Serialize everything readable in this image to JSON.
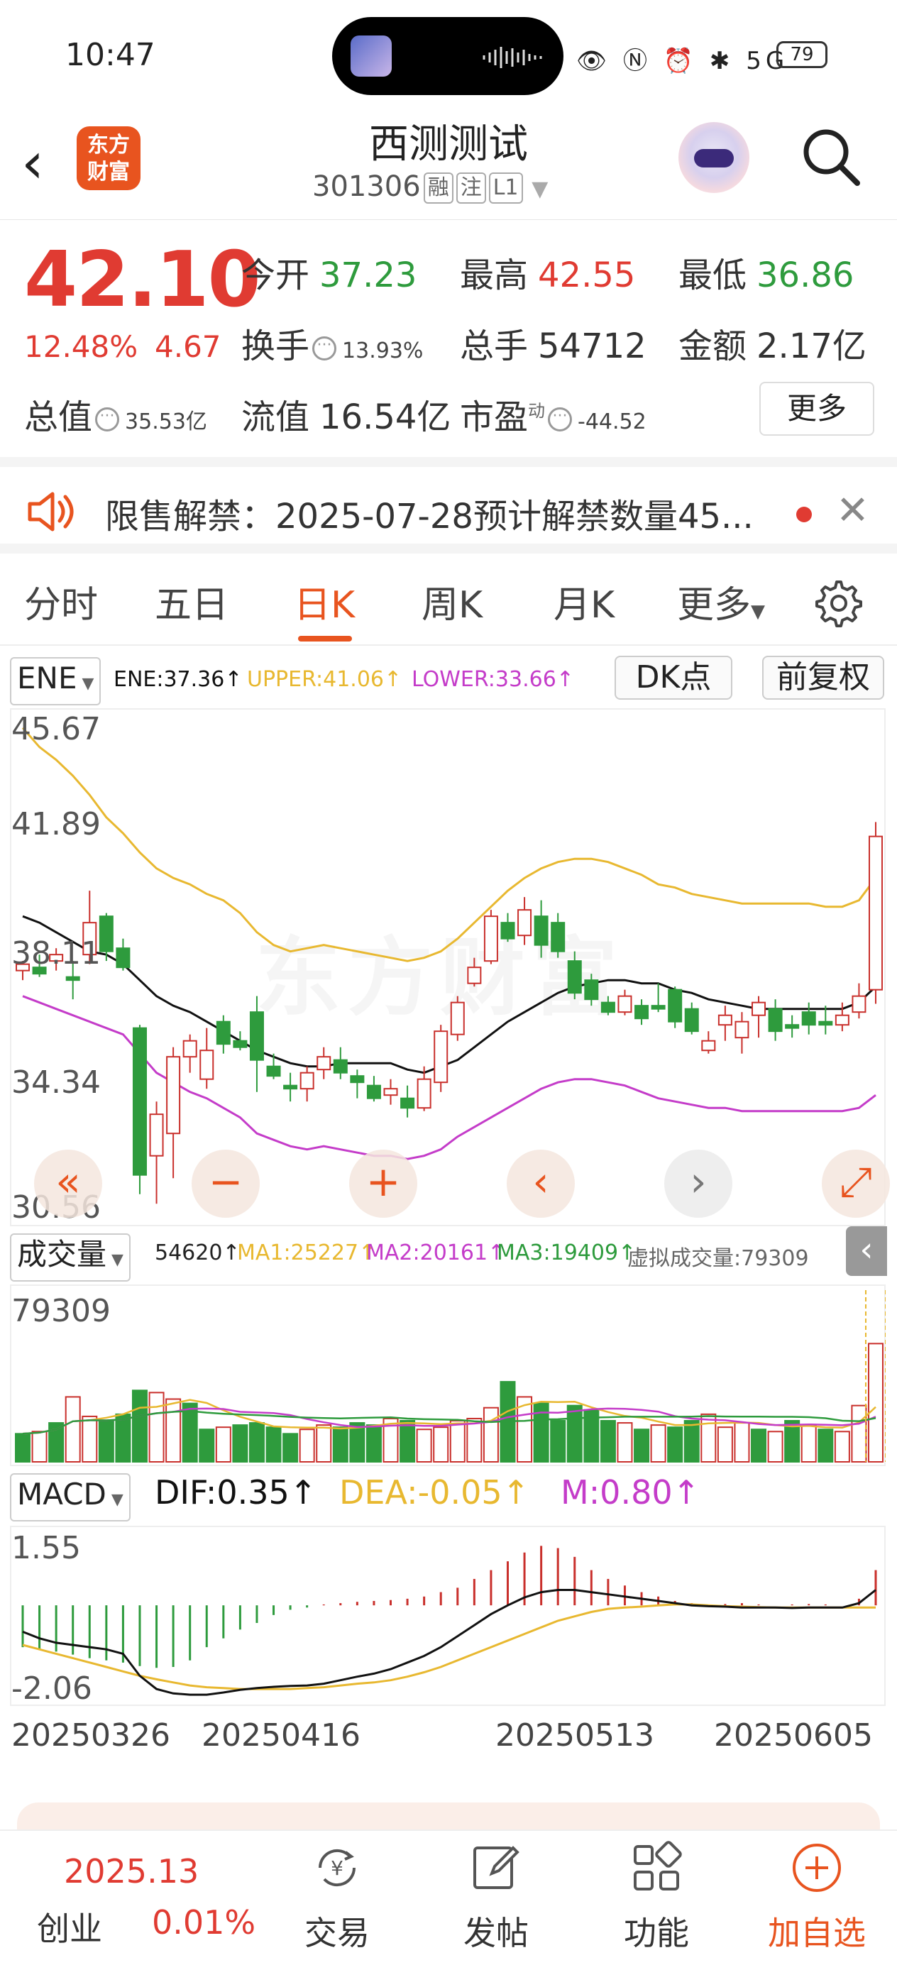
{
  "status_bar": {
    "time": "10:47",
    "icons": "👁 Ⓝ ⏰ ✱ 5G",
    "battery": "79"
  },
  "header": {
    "logo": "东方\n财富",
    "logo_l1": "东方",
    "logo_l2": "财富",
    "title": "西测测试",
    "code": "301306",
    "tags": [
      "融",
      "注",
      "L1"
    ]
  },
  "quote": {
    "price": "42.10",
    "change_pct": "12.48%",
    "change": "4.67",
    "open_label": "今开",
    "open": "37.23",
    "high_label": "最高",
    "high": "42.55",
    "low_label": "最低",
    "low": "36.86",
    "turnover_label": "换手",
    "turnover": "13.93%",
    "volume_label": "总手",
    "volume": "54712",
    "amount_label": "金额",
    "amount": "2.17亿",
    "mktcap_label": "总值",
    "mktcap": "35.53亿",
    "float_label": "流值",
    "float": "16.54亿",
    "pe_label": "市盈",
    "pe_sup": "动",
    "pe": "-44.52",
    "more": "更多"
  },
  "notice": {
    "text": "限售解禁：2025-07-28预计解禁数量45..."
  },
  "tabs": [
    "分时",
    "五日",
    "日K",
    "周K",
    "月K",
    "更多"
  ],
  "active_tab": "日K",
  "kline_legend": {
    "indicator": "ENE",
    "ene": "ENE:37.36↑",
    "upper": "UPPER:41.06↑",
    "lower": "LOWER:33.66↑",
    "dk": "DK点",
    "adjust": "前复权",
    "colors": {
      "ene": "#111111",
      "upper": "#e8b830",
      "lower": "#c43cc9",
      "up": "#c9302c",
      "down": "#2e9b3d"
    }
  },
  "kline_axis": {
    "max": "45.67",
    "l2": "41.89",
    "l3": "38.11",
    "l4": "34.34",
    "min": "30.56"
  },
  "volume_legend": {
    "indicator": "成交量",
    "vol": "54620↑",
    "ma1": "MA1:25227↑",
    "ma2": "MA2:20161↑",
    "ma3": "MA3:19409↑",
    "virtual": "虚拟成交量:79309",
    "max": "79309"
  },
  "macd_legend": {
    "indicator": "MACD",
    "dif": "DIF:0.35↑",
    "dea": "DEA:-0.05↑",
    "m": "M:0.80↑",
    "max": "1.55",
    "min": "-2.06"
  },
  "dates": [
    "20250326",
    "20250416",
    "20250513",
    "20250605"
  ],
  "controls": [
    "«",
    "−",
    "+",
    "‹",
    "›",
    "⤢"
  ],
  "bottom": {
    "index_value": "2025.13",
    "index_name": "创业",
    "index_pct": "0.01%",
    "items": [
      "交易",
      "发帖",
      "功能",
      "加自选"
    ]
  },
  "chart_data": {
    "type": "candlestick",
    "y_range": [
      30.56,
      45.67
    ],
    "candles": [
      [
        37.9,
        38.2,
        37.6,
        38.1
      ],
      [
        38.0,
        38.4,
        37.7,
        37.8
      ],
      [
        38.2,
        38.6,
        37.9,
        38.4
      ],
      [
        37.7,
        38.2,
        37.0,
        37.6
      ],
      [
        38.4,
        40.4,
        38.1,
        39.4
      ],
      [
        39.6,
        39.7,
        38.2,
        38.5
      ],
      [
        38.6,
        38.9,
        37.9,
        38.0
      ],
      [
        36.1,
        36.2,
        30.9,
        31.5
      ],
      [
        32.1,
        33.8,
        30.6,
        33.4
      ],
      [
        32.8,
        35.5,
        31.4,
        35.2
      ],
      [
        35.2,
        35.9,
        34.7,
        35.7
      ],
      [
        34.5,
        36.1,
        34.2,
        35.4
      ],
      [
        36.3,
        36.5,
        35.3,
        35.6
      ],
      [
        35.7,
        36.0,
        35.4,
        35.5
      ],
      [
        36.6,
        37.1,
        34.1,
        35.1
      ],
      [
        34.9,
        35.3,
        34.5,
        34.6
      ],
      [
        34.3,
        34.7,
        33.8,
        34.2
      ],
      [
        34.2,
        34.9,
        33.8,
        34.7
      ],
      [
        34.8,
        35.5,
        34.5,
        35.2
      ],
      [
        35.1,
        35.5,
        34.5,
        34.7
      ],
      [
        34.6,
        34.8,
        33.9,
        34.4
      ],
      [
        34.3,
        34.6,
        33.8,
        33.9
      ],
      [
        34.0,
        34.5,
        33.7,
        34.2
      ],
      [
        33.9,
        34.3,
        33.3,
        33.6
      ],
      [
        33.6,
        34.9,
        33.5,
        34.5
      ],
      [
        34.4,
        36.2,
        34.1,
        36.0
      ],
      [
        35.9,
        37.1,
        35.7,
        36.9
      ],
      [
        37.5,
        38.3,
        37.4,
        38.0
      ],
      [
        38.2,
        39.8,
        38.1,
        39.6
      ],
      [
        39.4,
        39.7,
        38.8,
        38.9
      ],
      [
        39.0,
        40.2,
        38.7,
        39.8
      ],
      [
        39.6,
        40.1,
        38.3,
        38.7
      ],
      [
        39.4,
        39.7,
        38.3,
        38.5
      ],
      [
        38.2,
        38.5,
        37.0,
        37.2
      ],
      [
        37.6,
        37.8,
        36.8,
        37.0
      ],
      [
        36.9,
        37.1,
        36.5,
        36.6
      ],
      [
        36.6,
        37.3,
        36.5,
        37.1
      ],
      [
        36.8,
        37.0,
        36.2,
        36.4
      ],
      [
        36.8,
        37.5,
        36.6,
        36.7
      ],
      [
        37.3,
        37.4,
        36.1,
        36.3
      ],
      [
        36.7,
        36.9,
        35.9,
        36.0
      ],
      [
        35.4,
        36.0,
        35.3,
        35.7
      ],
      [
        36.2,
        36.8,
        35.7,
        36.5
      ],
      [
        35.8,
        36.6,
        35.3,
        36.3
      ],
      [
        36.5,
        37.1,
        35.8,
        36.9
      ],
      [
        36.7,
        37.0,
        35.7,
        36.0
      ],
      [
        36.2,
        36.5,
        35.8,
        36.1
      ],
      [
        36.6,
        36.9,
        35.9,
        36.2
      ],
      [
        36.3,
        36.8,
        35.9,
        36.2
      ],
      [
        36.2,
        36.9,
        36.0,
        36.5
      ],
      [
        36.6,
        37.5,
        36.4,
        37.1
      ],
      [
        37.3,
        42.55,
        36.86,
        42.1
      ]
    ],
    "ene": [
      39.6,
      39.4,
      39.1,
      38.8,
      38.5,
      38.4,
      38.1,
      37.6,
      37.1,
      36.8,
      36.6,
      36.3,
      36.0,
      35.7,
      35.4,
      35.2,
      35.0,
      34.9,
      34.9,
      35.0,
      35.0,
      35.0,
      35.0,
      34.8,
      34.7,
      34.9,
      35.1,
      35.5,
      35.9,
      36.3,
      36.6,
      36.9,
      37.2,
      37.4,
      37.5,
      37.6,
      37.6,
      37.5,
      37.5,
      37.3,
      37.2,
      37.0,
      36.9,
      36.8,
      36.7,
      36.7,
      36.7,
      36.7,
      36.7,
      36.7,
      36.9,
      37.4
    ],
    "upper": [
      45.5,
      44.9,
      44.5,
      44.0,
      43.4,
      42.7,
      42.2,
      41.6,
      41.1,
      40.8,
      40.6,
      40.3,
      40.1,
      39.7,
      39.1,
      38.7,
      38.5,
      38.6,
      38.7,
      38.6,
      38.5,
      38.4,
      38.3,
      38.2,
      38.3,
      38.5,
      38.9,
      39.4,
      39.9,
      40.4,
      40.8,
      41.1,
      41.3,
      41.4,
      41.4,
      41.3,
      41.1,
      40.9,
      40.6,
      40.5,
      40.3,
      40.2,
      40.1,
      40.0,
      40.0,
      40.0,
      40.0,
      40.0,
      39.9,
      39.9,
      40.1,
      40.8
    ],
    "lower": [
      37.1,
      36.9,
      36.7,
      36.5,
      36.3,
      36.1,
      35.9,
      35.3,
      34.7,
      34.4,
      34.1,
      33.9,
      33.6,
      33.3,
      32.8,
      32.6,
      32.4,
      32.3,
      32.4,
      32.3,
      32.2,
      32.1,
      32.1,
      32.0,
      32.1,
      32.3,
      32.7,
      33.0,
      33.3,
      33.6,
      33.9,
      34.2,
      34.4,
      34.5,
      34.5,
      34.4,
      34.3,
      34.1,
      33.9,
      33.8,
      33.7,
      33.6,
      33.6,
      33.5,
      33.5,
      33.5,
      33.5,
      33.5,
      33.5,
      33.5,
      33.6,
      34.0
    ],
    "volume": [
      13000,
      14000,
      18000,
      30000,
      21000,
      19000,
      22000,
      33000,
      32000,
      29000,
      27000,
      15000,
      16000,
      17000,
      18000,
      16000,
      13000,
      15000,
      17000,
      16000,
      18000,
      17000,
      20000,
      19000,
      15000,
      16000,
      19000,
      20000,
      25000,
      37000,
      30000,
      27000,
      19000,
      26000,
      24000,
      19000,
      18000,
      15000,
      17000,
      16000,
      19000,
      22000,
      16000,
      18000,
      15000,
      14000,
      19000,
      17000,
      15000,
      14000,
      26000,
      54620
    ],
    "vol_up": [
      0,
      1,
      0,
      1,
      1,
      0,
      0,
      0,
      1,
      1,
      0,
      0,
      1,
      0,
      0,
      0,
      0,
      1,
      1,
      0,
      0,
      0,
      1,
      0,
      1,
      1,
      1,
      1,
      1,
      0,
      1,
      0,
      0,
      0,
      0,
      0,
      1,
      0,
      1,
      0,
      0,
      1,
      1,
      1,
      0,
      1,
      0,
      1,
      0,
      1,
      1,
      1
    ],
    "macd_hist": [
      -0.95,
      -1.0,
      -1.05,
      -1.12,
      -1.2,
      -1.25,
      -1.3,
      -1.38,
      -1.42,
      -1.4,
      -1.25,
      -0.95,
      -0.75,
      -0.55,
      -0.4,
      -0.22,
      -0.1,
      -0.05,
      0.02,
      0.05,
      0.08,
      0.1,
      0.12,
      0.15,
      0.2,
      0.3,
      0.4,
      0.6,
      0.8,
      1.0,
      1.2,
      1.35,
      1.3,
      1.1,
      0.8,
      0.6,
      0.45,
      0.3,
      0.2,
      0.1,
      0.05,
      0.0,
      0.03,
      0.05,
      0.02,
      0.0,
      0.02,
      0.03,
      0.02,
      0.0,
      0.15,
      0.8
    ],
    "dif": [
      -0.6,
      -0.75,
      -0.85,
      -0.9,
      -0.95,
      -1.0,
      -1.1,
      -1.6,
      -1.9,
      -2.0,
      -2.03,
      -2.03,
      -1.98,
      -1.92,
      -1.88,
      -1.85,
      -1.83,
      -1.82,
      -1.78,
      -1.7,
      -1.62,
      -1.55,
      -1.45,
      -1.3,
      -1.15,
      -0.95,
      -0.7,
      -0.45,
      -0.2,
      0.0,
      0.18,
      0.3,
      0.35,
      0.35,
      0.3,
      0.25,
      0.2,
      0.15,
      0.1,
      0.05,
      0.0,
      -0.02,
      -0.03,
      -0.05,
      -0.05,
      -0.05,
      -0.06,
      -0.05,
      -0.05,
      -0.05,
      0.05,
      0.35
    ],
    "dea": [
      -0.9,
      -1.0,
      -1.1,
      -1.2,
      -1.3,
      -1.4,
      -1.5,
      -1.6,
      -1.68,
      -1.75,
      -1.82,
      -1.86,
      -1.88,
      -1.9,
      -1.9,
      -1.9,
      -1.9,
      -1.88,
      -1.86,
      -1.82,
      -1.78,
      -1.75,
      -1.7,
      -1.62,
      -1.52,
      -1.4,
      -1.25,
      -1.1,
      -0.95,
      -0.8,
      -0.65,
      -0.5,
      -0.35,
      -0.25,
      -0.15,
      -0.08,
      -0.05,
      -0.03,
      0.0,
      0.02,
      0.02,
      0.0,
      -0.02,
      -0.03,
      -0.04,
      -0.05,
      -0.05,
      -0.05,
      -0.05,
      -0.05,
      -0.05,
      -0.05
    ]
  }
}
